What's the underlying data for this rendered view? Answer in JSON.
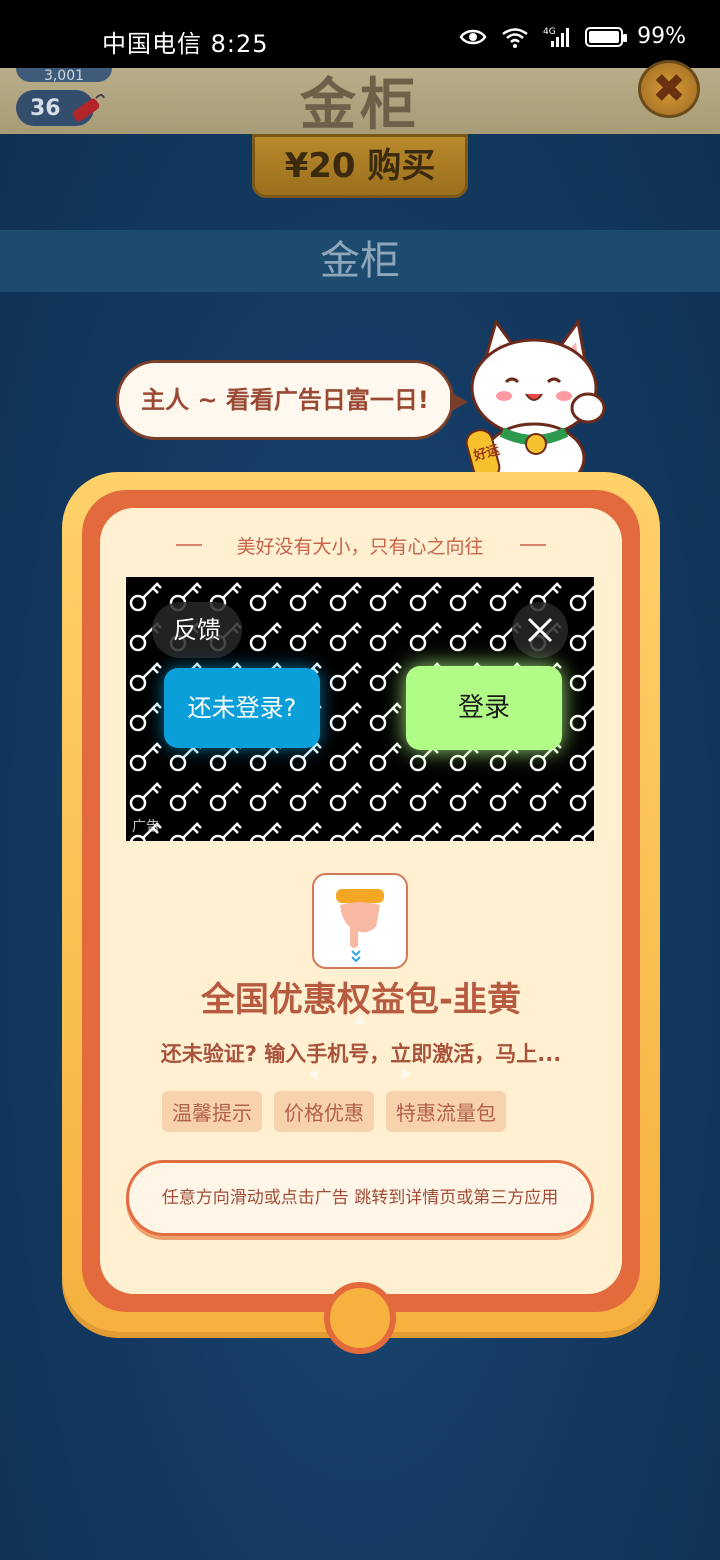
{
  "status_bar": {
    "carrier_time": "中国电信 8:25",
    "signal_label": "4G",
    "battery": "99%"
  },
  "game_header": {
    "coin_count": "3,001",
    "dynamite_count": "36",
    "title": "金柜",
    "buy_label": "¥20 购买",
    "section_title": "金柜"
  },
  "bubble": {
    "text": "主人 ~ 看看广告日富一日!"
  },
  "mascot": {
    "badge_text": "好运"
  },
  "card": {
    "motto": "美好没有大小，只有心之向往",
    "ad": {
      "feedback_label": "反馈",
      "left_button": "还未登录?",
      "right_button": "登录",
      "ad_label": "广告"
    },
    "app_title": "全国优惠权益包-韭黄",
    "app_desc": "还未验证? 输入手机号，立即激活，马上...",
    "tags": [
      "温馨提示",
      "价格优惠",
      "特惠流量包"
    ],
    "cta": "任意方向滑动或点击广告 跳转到详情页或第三方应用"
  },
  "colors": {
    "frame_gold": "#f6b13f",
    "frame_red": "#e26a3c",
    "card_bg": "#fff0d2",
    "ad_blue": "#0a9fd8",
    "ad_green": "#b1fb87"
  }
}
